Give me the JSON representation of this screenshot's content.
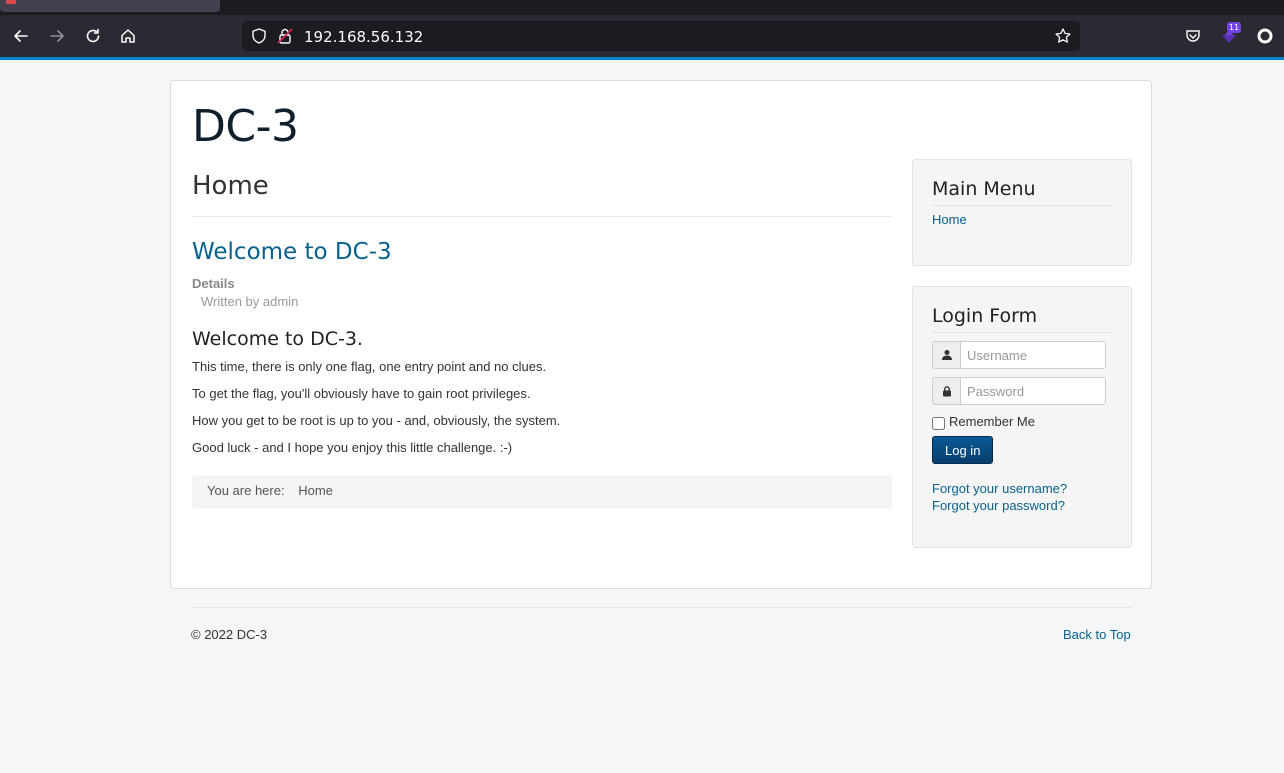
{
  "browser": {
    "url": "192.168.56.132",
    "extension_badge": "11",
    "colors": {
      "toolbar": "#2b2a33",
      "urlbar": "#1c1b22",
      "accent": "#0a84c9"
    }
  },
  "site": {
    "brand": "DC-3",
    "page_header": "Home",
    "article": {
      "title": "Welcome to DC-3",
      "details_label": "Details",
      "written_by": "Written by admin",
      "heading": "Welcome to DC-3.",
      "paragraphs": [
        "This time, there is only one flag, one entry point and no clues.",
        "To get the flag, you'll obviously have to gain root privileges.",
        "How you get to be root is up to you - and, obviously, the system.",
        "Good luck - and I hope you enjoy this little challenge.  :-)"
      ]
    },
    "breadcrumb": {
      "label": "You are here:",
      "current": "Home"
    },
    "main_menu": {
      "title": "Main Menu",
      "items": [
        "Home"
      ]
    },
    "login_form": {
      "title": "Login Form",
      "username_placeholder": "Username",
      "password_placeholder": "Password",
      "remember_label": "Remember Me",
      "submit_label": "Log in",
      "forgot_username": "Forgot your username?",
      "forgot_password": "Forgot your password?"
    },
    "footer": {
      "copyright": "© 2022 DC-3",
      "back_to_top": "Back to Top"
    },
    "colors": {
      "link": "#08628d",
      "button": "#0b5a95",
      "page_bg": "#f4f6f7"
    }
  }
}
